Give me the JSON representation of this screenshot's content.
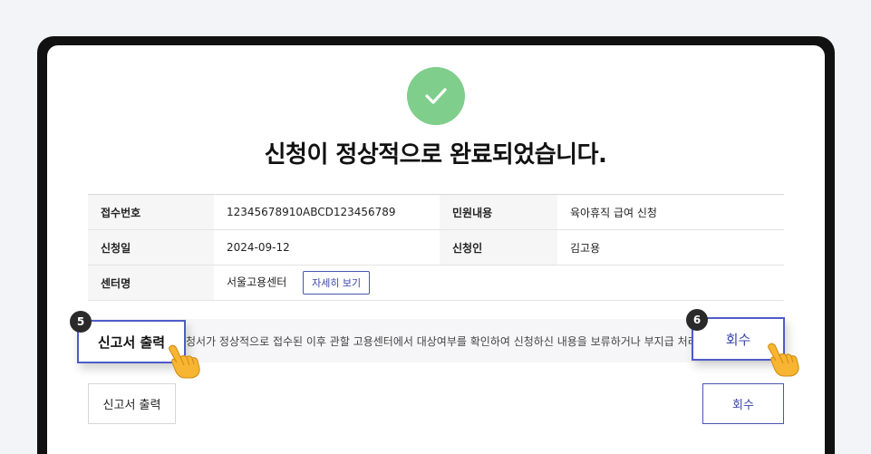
{
  "title": "신청이 정상적으로 완료되었습니다.",
  "info": {
    "receipt_no_label": "접수번호",
    "receipt_no_value": "12345678910ABCD123456789",
    "petition_label": "민원내용",
    "petition_value": "육아휴직 급여 신청",
    "apply_date_label": "신청일",
    "apply_date_value": "2024-09-12",
    "applicant_label": "신청인",
    "applicant_value": "김고용",
    "center_label": "센터명",
    "center_value": "서울고용센터",
    "detail_button": "자세히 보기"
  },
  "notice_text": "청서가 정상적으로 접수된 이후 관할 고용센터에서 대상여부를 확인하여 신청하신 내용을 보류하거나 부지급 처리",
  "buttons": {
    "print_label": "신고서 출력",
    "recall_label": "회수"
  },
  "steps": {
    "print_step": "5",
    "recall_step": "6"
  },
  "colors": {
    "success": "#7fce8b",
    "accent": "#4f5cc7",
    "device_frame": "#111111"
  },
  "icons": {
    "success": "check-icon",
    "pointer": "pointing-hand-icon"
  }
}
